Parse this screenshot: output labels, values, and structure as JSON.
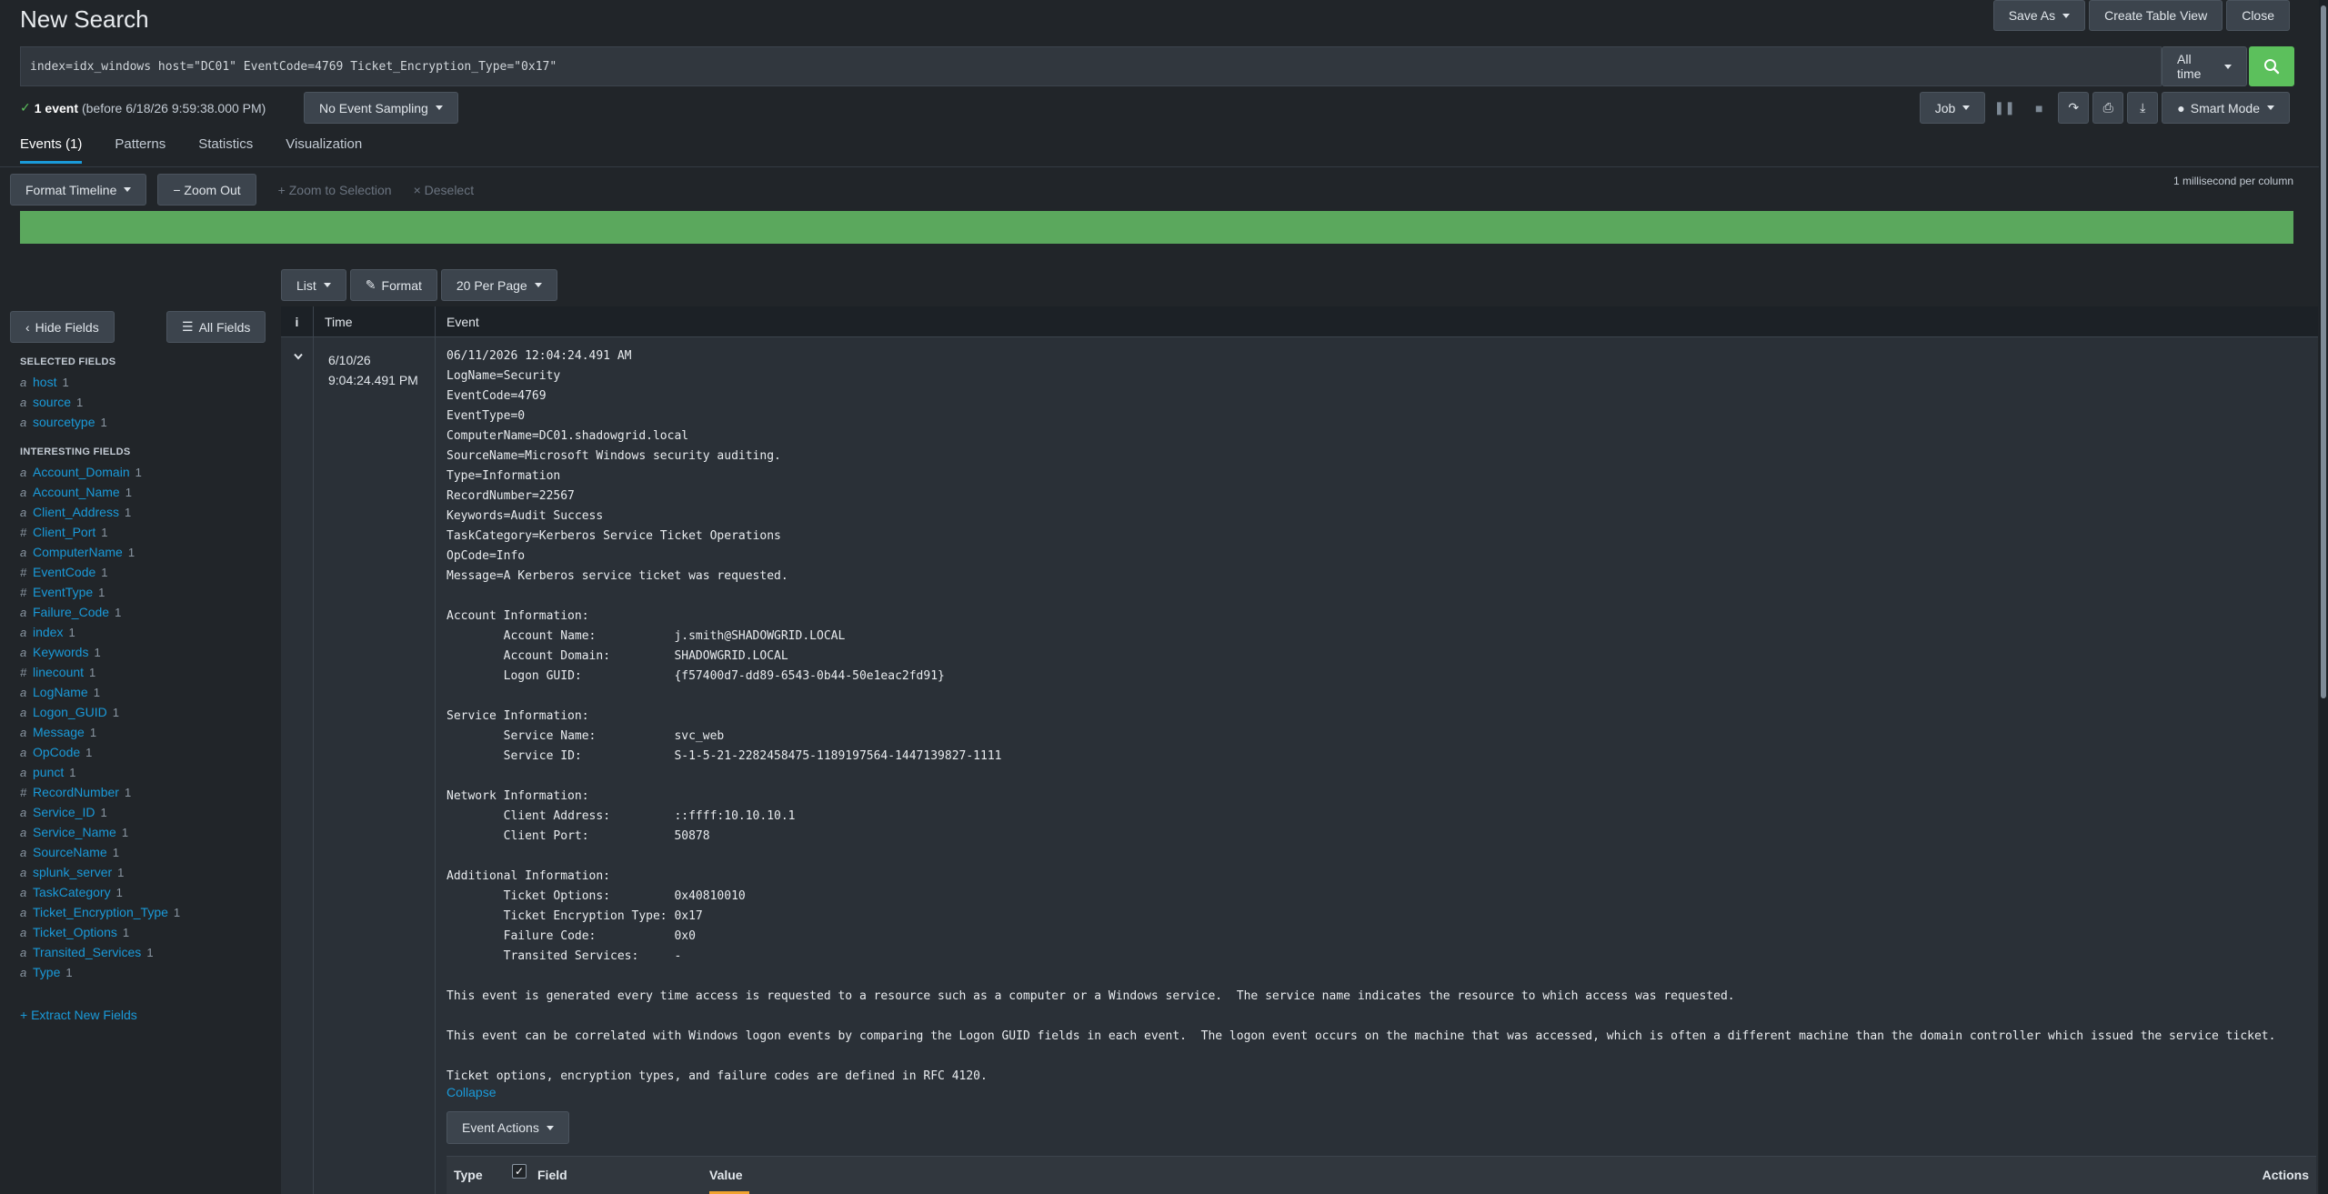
{
  "header": {
    "title": "New Search",
    "save_as": "Save As",
    "create_table_view": "Create Table View",
    "close": "Close"
  },
  "search": {
    "query": "index=idx_windows host=\"DC01\"  EventCode=4769 Ticket_Encryption_Type=\"0x17\"",
    "time_range": "All time"
  },
  "status": {
    "count": "1 event",
    "detail": "(before 6/18/26 9:59:38.000 PM)",
    "sampling": "No Event Sampling",
    "job": "Job",
    "mode": "Smart Mode"
  },
  "tabs": [
    {
      "label": "Events (1)",
      "active": true
    },
    {
      "label": "Patterns",
      "active": false
    },
    {
      "label": "Statistics",
      "active": false
    },
    {
      "label": "Visualization",
      "active": false
    }
  ],
  "timeline": {
    "format": "Format Timeline",
    "zoom_out": "− Zoom Out",
    "zoom_selection": "+ Zoom to Selection",
    "deselect": "× Deselect",
    "scale": "1 millisecond per column",
    "bar_color": "#5ba85d"
  },
  "results_toolbar": {
    "list": "List",
    "format": "Format",
    "per_page": "20 Per Page"
  },
  "sidebar": {
    "hide_fields": "Hide Fields",
    "all_fields": "All Fields",
    "selected_title": "SELECTED FIELDS",
    "selected": [
      {
        "type": "a",
        "name": "host",
        "count": "1"
      },
      {
        "type": "a",
        "name": "source",
        "count": "1"
      },
      {
        "type": "a",
        "name": "sourcetype",
        "count": "1"
      }
    ],
    "interesting_title": "INTERESTING FIELDS",
    "interesting": [
      {
        "type": "a",
        "name": "Account_Domain",
        "count": "1"
      },
      {
        "type": "a",
        "name": "Account_Name",
        "count": "1"
      },
      {
        "type": "a",
        "name": "Client_Address",
        "count": "1"
      },
      {
        "type": "#",
        "name": "Client_Port",
        "count": "1"
      },
      {
        "type": "a",
        "name": "ComputerName",
        "count": "1"
      },
      {
        "type": "#",
        "name": "EventCode",
        "count": "1"
      },
      {
        "type": "#",
        "name": "EventType",
        "count": "1"
      },
      {
        "type": "a",
        "name": "Failure_Code",
        "count": "1"
      },
      {
        "type": "a",
        "name": "index",
        "count": "1"
      },
      {
        "type": "a",
        "name": "Keywords",
        "count": "1"
      },
      {
        "type": "#",
        "name": "linecount",
        "count": "1"
      },
      {
        "type": "a",
        "name": "LogName",
        "count": "1"
      },
      {
        "type": "a",
        "name": "Logon_GUID",
        "count": "1"
      },
      {
        "type": "a",
        "name": "Message",
        "count": "1"
      },
      {
        "type": "a",
        "name": "OpCode",
        "count": "1"
      },
      {
        "type": "a",
        "name": "punct",
        "count": "1"
      },
      {
        "type": "#",
        "name": "RecordNumber",
        "count": "1"
      },
      {
        "type": "a",
        "name": "Service_ID",
        "count": "1"
      },
      {
        "type": "a",
        "name": "Service_Name",
        "count": "1"
      },
      {
        "type": "a",
        "name": "SourceName",
        "count": "1"
      },
      {
        "type": "a",
        "name": "splunk_server",
        "count": "1"
      },
      {
        "type": "a",
        "name": "TaskCategory",
        "count": "1"
      },
      {
        "type": "a",
        "name": "Ticket_Encryption_Type",
        "count": "1"
      },
      {
        "type": "a",
        "name": "Ticket_Options",
        "count": "1"
      },
      {
        "type": "a",
        "name": "Transited_Services",
        "count": "1"
      },
      {
        "type": "a",
        "name": "Type",
        "count": "1"
      }
    ],
    "extract": "+ Extract New Fields"
  },
  "events_table": {
    "col_i": "i",
    "col_time": "Time",
    "col_event": "Event",
    "row": {
      "date": "6/10/26",
      "time": "9:04:24.491 PM",
      "raw": "06/11/2026 12:04:24.491 AM\nLogName=Security\nEventCode=4769\nEventType=0\nComputerName=DC01.shadowgrid.local\nSourceName=Microsoft Windows security auditing.\nType=Information\nRecordNumber=22567\nKeywords=Audit Success\nTaskCategory=Kerberos Service Ticket Operations\nOpCode=Info\nMessage=A Kerberos service ticket was requested.\n\nAccount Information:\n\tAccount Name:\t\tj.smith@SHADOWGRID.LOCAL\n\tAccount Domain:\t\tSHADOWGRID.LOCAL\n\tLogon GUID:\t\t{f57400d7-dd89-6543-0b44-50e1eac2fd91}\n\nService Information:\n\tService Name:\t\tsvc_web\n\tService ID:\t\tS-1-5-21-2282458475-1189197564-1447139827-1111\n\nNetwork Information:\n\tClient Address:\t\t::ffff:10.10.10.1\n\tClient Port:\t\t50878\n\nAdditional Information:\n\tTicket Options:\t\t0x40810010\n\tTicket Encryption Type:\t0x17\n\tFailure Code:\t\t0x0\n\tTransited Services:\t-\n\nThis event is generated every time access is requested to a resource such as a computer or a Windows service.  The service name indicates the resource to which access was requested.\n\nThis event can be correlated with Windows logon events by comparing the Logon GUID fields in each event.  The logon event occurs on the machine that was accessed, which is often a different machine than the domain controller which issued the service ticket.\n\nTicket options, encryption types, and failure codes are defined in RFC 4120.",
      "collapse": "Collapse",
      "event_actions": "Event Actions",
      "fv_type": "Type",
      "fv_field": "Field",
      "fv_value": "Value",
      "fv_actions": "Actions"
    }
  },
  "colors": {
    "accent": "#1a9ad9",
    "success": "#5cc05c",
    "background": "#212529"
  }
}
